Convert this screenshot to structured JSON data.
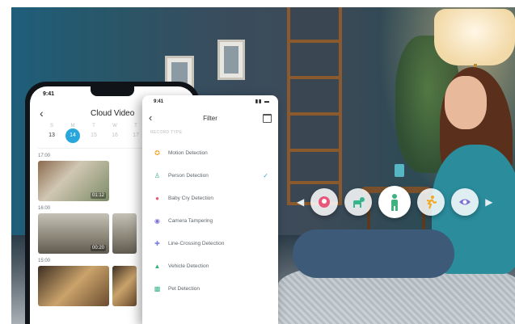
{
  "back_phone": {
    "status_time": "9:41",
    "title": "Cloud Video",
    "weekdays": [
      "S",
      "M",
      "T",
      "W",
      "T"
    ],
    "dates": [
      "13",
      "14",
      "15",
      "16",
      "17"
    ],
    "selected_date": "14",
    "groups": [
      {
        "time": "17:00",
        "clips": [
          {
            "duration": "01:12"
          }
        ]
      },
      {
        "time": "16:00",
        "clips": [
          {
            "duration": "00:20"
          },
          {
            "duration": ""
          }
        ]
      },
      {
        "time": "15:00",
        "clips": [
          {
            "duration": ""
          },
          {
            "duration": ""
          }
        ]
      }
    ]
  },
  "filter_phone": {
    "status_time": "9:41",
    "title": "Filter",
    "section_label": "RECORD TYPE",
    "items": [
      {
        "label": "Motion Detection",
        "icon": "motion-icon",
        "color": "#f5a623",
        "selected": false
      },
      {
        "label": "Person Detection",
        "icon": "person-icon",
        "color": "#3fb27f",
        "selected": true
      },
      {
        "label": "Baby Cry Detection",
        "icon": "baby-cry-icon",
        "color": "#e8577a",
        "selected": false
      },
      {
        "label": "Camera Tampering",
        "icon": "camera-tampering-icon",
        "color": "#7a6fd6",
        "selected": false
      },
      {
        "label": "Line-Crossing Detection",
        "icon": "line-crossing-icon",
        "color": "#7d7fe0",
        "selected": false
      },
      {
        "label": "Vehicle Detection",
        "icon": "vehicle-icon",
        "color": "#2fb57a",
        "selected": false
      },
      {
        "label": "Pet Detection",
        "icon": "pet-icon",
        "color": "#36b58a",
        "selected": false
      }
    ]
  },
  "colors": {
    "accent": "#29a6dc",
    "check": "#2ea3da"
  },
  "detection_bubbles": [
    "baby-cry-icon",
    "pet-icon",
    "person-icon",
    "motion-icon",
    "camera-tampering-icon"
  ]
}
